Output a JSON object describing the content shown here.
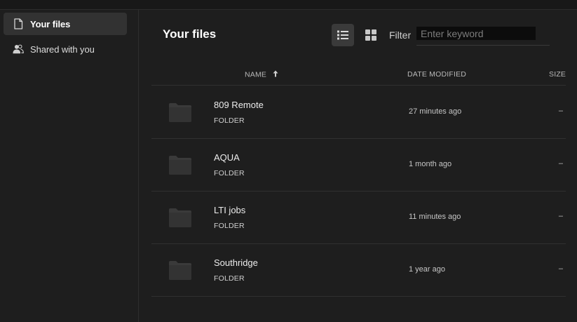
{
  "sidebar": {
    "items": [
      {
        "label": "Your files",
        "icon": "document-icon",
        "active": true
      },
      {
        "label": "Shared with you",
        "icon": "users-icon",
        "active": false
      }
    ]
  },
  "header": {
    "title": "Your files",
    "filter_label": "Filter",
    "filter_placeholder": "Enter keyword",
    "filter_value": "",
    "view_mode": "list"
  },
  "table": {
    "columns": {
      "name": "NAME",
      "date_modified": "DATE MODIFIED",
      "size": "SIZE"
    },
    "sort": {
      "column": "name",
      "direction": "ascending"
    },
    "rows": [
      {
        "name": "809 Remote",
        "type": "FOLDER",
        "modified": "27 minutes ago",
        "size": "–"
      },
      {
        "name": "AQUA",
        "type": "FOLDER",
        "modified": "1 month ago",
        "size": "–"
      },
      {
        "name": "LTI jobs",
        "type": "FOLDER",
        "modified": "11 minutes ago",
        "size": "–"
      },
      {
        "name": "Southridge",
        "type": "FOLDER",
        "modified": "1 year ago",
        "size": "–"
      }
    ]
  },
  "colors": {
    "background": "#1e1e1e",
    "sidebar_active": "#323232",
    "folder_icon": "#3a3a3a",
    "divider": "#303030"
  }
}
